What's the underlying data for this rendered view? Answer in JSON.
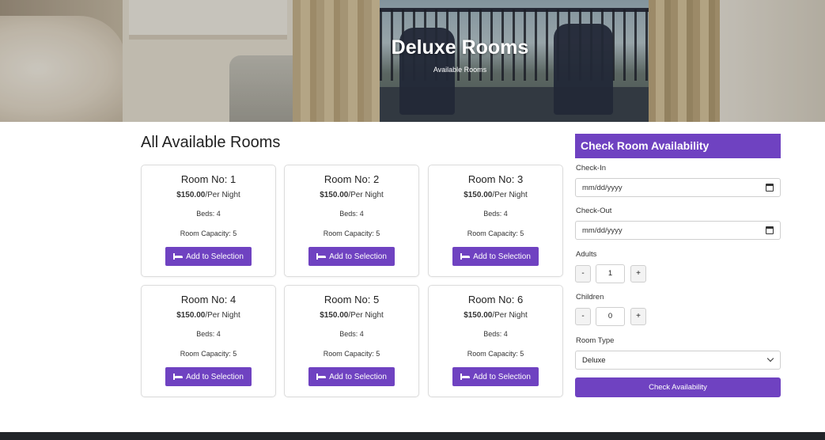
{
  "hero": {
    "title": "Deluxe Rooms",
    "subtitle": "Available Rooms"
  },
  "main": {
    "section_title": "All Available Rooms",
    "rooms": [
      {
        "room_no": "Room No: 1",
        "price": "$150.00",
        "price_unit": "/Per Night",
        "beds": "Beds: 4",
        "capacity": "Room Capacity: 5",
        "button": "Add to Selection"
      },
      {
        "room_no": "Room No: 2",
        "price": "$150.00",
        "price_unit": "/Per Night",
        "beds": "Beds: 4",
        "capacity": "Room Capacity: 5",
        "button": "Add to Selection"
      },
      {
        "room_no": "Room No: 3",
        "price": "$150.00",
        "price_unit": "/Per Night",
        "beds": "Beds: 4",
        "capacity": "Room Capacity: 5",
        "button": "Add to Selection"
      },
      {
        "room_no": "Room No: 4",
        "price": "$150.00",
        "price_unit": "/Per Night",
        "beds": "Beds: 4",
        "capacity": "Room Capacity: 5",
        "button": "Add to Selection"
      },
      {
        "room_no": "Room No: 5",
        "price": "$150.00",
        "price_unit": "/Per Night",
        "beds": "Beds: 4",
        "capacity": "Room Capacity: 5",
        "button": "Add to Selection"
      },
      {
        "room_no": "Room No: 6",
        "price": "$150.00",
        "price_unit": "/Per Night",
        "beds": "Beds: 4",
        "capacity": "Room Capacity: 5",
        "button": "Add to Selection"
      }
    ]
  },
  "sidebar": {
    "heading": "Check Room Availability",
    "checkin_label": "Check-In",
    "checkin_value": "mm/dd/yyyy",
    "checkout_label": "Check-Out",
    "checkout_value": "mm/dd/yyyy",
    "adults_label": "Adults",
    "adults_value": "1",
    "children_label": "Children",
    "children_value": "0",
    "minus": "-",
    "plus": "+",
    "room_type_label": "Room Type",
    "room_type_value": "Deluxe",
    "submit": "Check Availability"
  },
  "icons": {
    "add_button_icon": "bed-icon",
    "date_icon": "calendar-icon",
    "select_icon": "chevron-down-icon"
  },
  "colors": {
    "accent": "#6f42c1",
    "footer": "#222529"
  }
}
